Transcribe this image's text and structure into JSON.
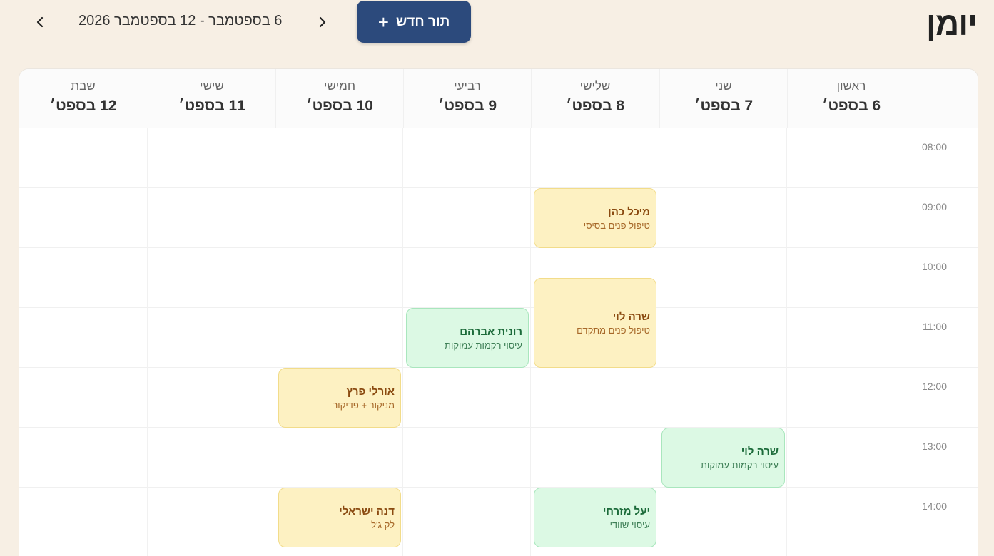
{
  "header": {
    "title": "יומן",
    "new_button_label": "תור חדש",
    "date_range": "6 בספטמבר - 12 בספטמבר 2026"
  },
  "days": [
    {
      "name": "ראשון",
      "date": "6 בספט׳"
    },
    {
      "name": "שני",
      "date": "7 בספט׳"
    },
    {
      "name": "שלישי",
      "date": "8 בספט׳"
    },
    {
      "name": "רביעי",
      "date": "9 בספט׳"
    },
    {
      "name": "חמישי",
      "date": "10 בספט׳"
    },
    {
      "name": "שישי",
      "date": "11 בספט׳"
    },
    {
      "name": "שבת",
      "date": "12 בספט׳"
    }
  ],
  "times": [
    "08:00",
    "09:00",
    "10:00",
    "11:00",
    "12:00",
    "13:00",
    "14:00"
  ],
  "appointments": [
    {
      "client": "מיכל כהן",
      "service": "טיפול פנים בסיסי",
      "color": "yellow"
    },
    {
      "client": "שרה לוי",
      "service": "טיפול פנים מתקדם",
      "color": "yellow"
    },
    {
      "client": "רונית אברהם",
      "service": "עיסוי רקמות עמוקות",
      "color": "green"
    },
    {
      "client": "אורלי פרץ",
      "service": "מניקור + פדיקור",
      "color": "yellow"
    },
    {
      "client": "שרה לוי",
      "service": "עיסוי רקמות עמוקות",
      "color": "green"
    },
    {
      "client": "דנה ישראלי",
      "service": "לק ג'ל",
      "color": "yellow"
    },
    {
      "client": "יעל מזרחי",
      "service": "עיסוי שוודי",
      "color": "green"
    }
  ],
  "colors": {
    "accent": "#2c4a7c",
    "background": "#f7efe4",
    "yellow": "#fdf1c2",
    "green": "#dcf9e4"
  },
  "icons": {
    "prev": "chevron-left-icon",
    "next": "chevron-right-icon",
    "add": "plus-icon"
  }
}
